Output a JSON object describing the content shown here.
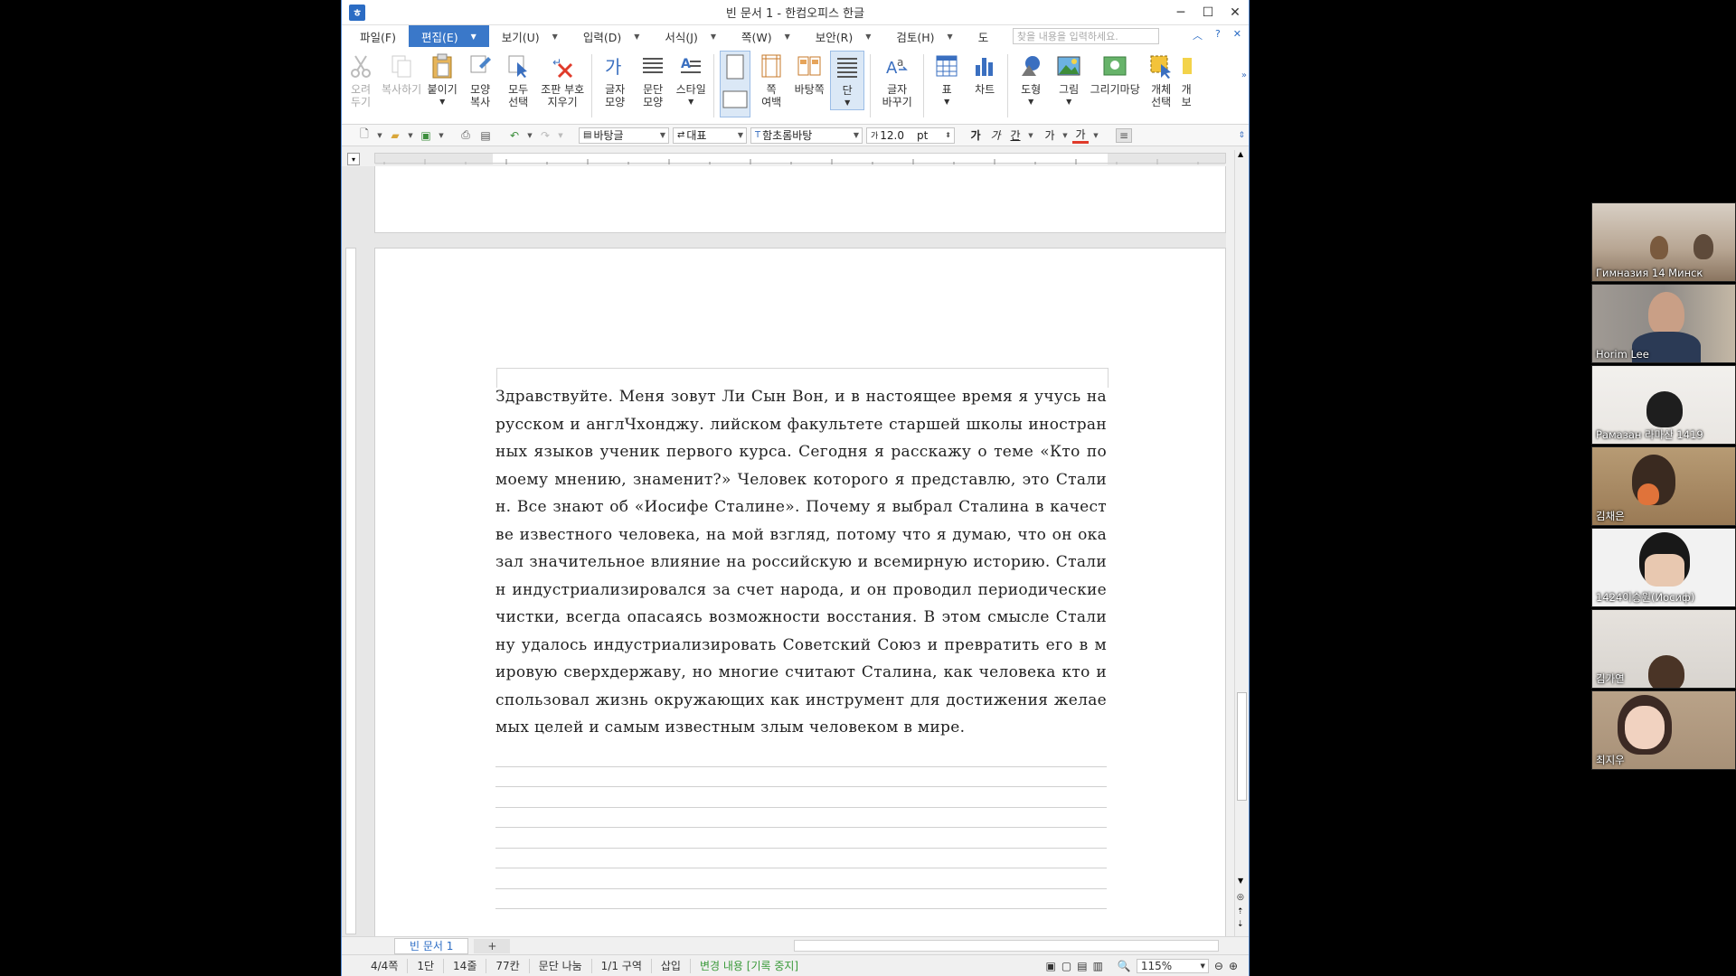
{
  "window": {
    "title": "빈 문서 1 - 한컴오피스 한글",
    "app_icon": "hwp-logo-icon",
    "controls": [
      "minimize",
      "maximize",
      "close"
    ]
  },
  "menu": {
    "items": [
      {
        "label": "파일(F)",
        "active": false
      },
      {
        "label": "편집(E)",
        "active": true
      },
      {
        "label": "보기(U)",
        "active": false
      },
      {
        "label": "입력(D)",
        "active": false
      },
      {
        "label": "서식(J)",
        "active": false
      },
      {
        "label": "쪽(W)",
        "active": false
      },
      {
        "label": "보안(R)",
        "active": false
      },
      {
        "label": "검토(H)",
        "active": false
      },
      {
        "label": "도",
        "active": false
      }
    ],
    "search_placeholder": "찾을 내용을 입력하세요."
  },
  "ribbon": {
    "cut": "오려\n두기",
    "copy": "복사하기",
    "paste": "붙이기",
    "format_copy": "모양\n복사",
    "select_all": "모두\n선택",
    "erase_marks": "조판 부호\n지우기",
    "char_shape": "글자\n모양",
    "para_shape": "문단\n모양",
    "style": "스타일",
    "page_margin": "쪽\n여백",
    "background": "바탕쪽",
    "column": "단",
    "replace": "글자\n바꾸기",
    "table": "표",
    "chart": "차트",
    "shape": "도형",
    "picture": "그림",
    "drawing": "그리기마당",
    "object_select": "개체\n선택",
    "more": "개\n보"
  },
  "format_bar": {
    "style_combo": "바탕글",
    "lang_combo": "대표",
    "font_combo": "함초롬바탕",
    "size_value": "12.0",
    "size_unit": "pt",
    "bold": "가",
    "italic": "가",
    "underline": "간",
    "strike": "가",
    "color": "가"
  },
  "document": {
    "text": "Здравствуйте. Меня зовут Ли Сын Вон, и в настоящее время я учусь на русском и англЧхонджу. лийском факультете старшей школы иностранных языков ученик первого курса. Сегодня я расскажу о теме «Кто по моему мнению, знаменит?» Человек которого я представлю, это Сталин. Все знают об «Иосифе Сталине». Почему я выбрал Сталина в качестве известного человека, на мой взгляд, потому что я думаю, что он оказал значительное влияние на российскую и всемирную историю. Сталин индустриализировался за счет народа, и он проводил периодические чистки, всегда опасаясь возможности восстания. В этом смысле Сталину удалось индустриализировать Советский Союз и превратить его в мировую сверхдержаву, но многие считают Сталина, как человека кто использовал жизнь окружающих как инструмент для достижения желаемых целей и самым известным злым человеком в мире."
  },
  "tabs": {
    "doc_tab": "빈 문서 1",
    "add": "+"
  },
  "status": {
    "page": "4/4쪽",
    "column": "1단",
    "line": "14줄",
    "col": "77칸",
    "break": "문단 나눔",
    "section": "1/1 구역",
    "mode": "삽입",
    "track": "변경 내용 [기록 중지]",
    "zoom": "115%"
  },
  "participants": [
    {
      "name": "Гимназия 14 Минск",
      "bg": "#b7a592"
    },
    {
      "name": "Horim Lee",
      "bg": "#8e8a86"
    },
    {
      "name": "Рамазан 라마산 1419",
      "bg": "#e9e6e2"
    },
    {
      "name": "김채은",
      "bg": "#9a7a55"
    },
    {
      "name": "1424이승원(Иосиф)",
      "bg": "#f2f2f2"
    },
    {
      "name": "김가연",
      "bg": "#d8d4cf"
    },
    {
      "name": "최지우",
      "bg": "#a89178"
    }
  ]
}
